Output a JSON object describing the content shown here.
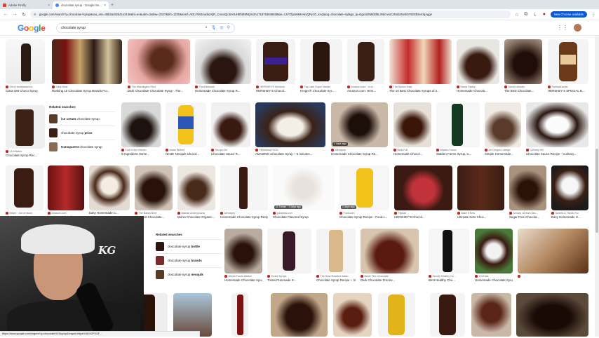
{
  "browser": {
    "tabs": [
      {
        "label": "Adobe Firefly",
        "active": false,
        "icon_color": "#e03c31"
      },
      {
        "label": "chocolate syrup - Google Se...",
        "active": true,
        "icon_color": "#4285f4"
      }
    ],
    "address": "google.com/search?q=chocolate+syrup&sca_esv=35b2ac82d41e2146&hl=en&udm=2&biw=2327&bih=1230&sxsrf=ADLYWIJcwdn2XjR_CmcxQLbm0UHBNE9NQ%3A1716753848528&ei=cJV7ZpUHBKAkvQPy1O_kAQ&oq=chocolate+syl&gs_lp=Egxnd3Mtd2l6LXNlcnAiC2Nob2NvbGF0ZSBzeXIqAggA",
    "new_chrome_label": "New Chrome available",
    "status_url": "https://www.google.com/imgres?q=chocolate%20syrup&imgurl=https%3A%2F%2F..."
  },
  "search": {
    "query": "chocolate syrup",
    "logo": "Google"
  },
  "colors": {
    "accent_blue": "#1a73e8",
    "chrome_blue": "#0b57d0"
  },
  "related_searches_1": {
    "heading": "Related searches",
    "items": [
      {
        "bold": "ice cream",
        "rest": " chocolate syrup"
      },
      {
        "bold": "",
        "rest": "chocolate syrup ",
        "tail": "price"
      },
      {
        "bold": "transparent",
        "rest": " chocolate syrup"
      }
    ]
  },
  "related_searches_2": {
    "heading": "Related searches",
    "items": [
      {
        "rest": "chocolate syrup ",
        "tail": "bottle"
      },
      {
        "rest": "chocolate syrup ",
        "tail": "brands"
      },
      {
        "rest": "chocolate syrup ",
        "tail": "nesquik"
      }
    ]
  },
  "results": [
    {
      "source": "Ohio Homestead Inc.",
      "title": "Class DM Choco Syrup"
    },
    {
      "source": "Daily Meal",
      "title": "Ranking 10 Chocolate Syrup Brands Fro..."
    },
    {
      "source": "The Washington Post",
      "title": "Dark Chocolate Chocolate Syrup - The..."
    },
    {
      "source": "Food Network",
      "title": "Homemade Chocolate Syrup R..."
    },
    {
      "source": "HERSHEY'S Kitchens",
      "title": "HERSHEY'S Chocol..."
    },
    {
      "source": "Fay Lake Super Market",
      "title": "Kroger® Chocolate Syr..."
    },
    {
      "source": "Amazon.com · In st...",
      "title": "Amazon.com: Hers..."
    },
    {
      "source": "The Spruce Eats",
      "title": "The 10 Best Chocolate Syrups of 2..."
    },
    {
      "source": "Rama Family",
      "title": "Homemade Chocola..."
    },
    {
      "source": "David Lebovitz",
      "title": "The Best Chocolate..."
    },
    {
      "source": "Pantry&Larder",
      "title": "HERSHEY'S SPECIAL D..."
    },
    {
      "source": "I Am Baker",
      "title": "Chocolate Syrup Rec..."
    },
    {
      "source": "Fork in the Kitchen",
      "title": "5-Ingredient Home..."
    },
    {
      "source": "Water Butlers",
      "title": "Nestle Nesquik Chocol..."
    },
    {
      "source": "Recipe Girl",
      "title": "Chocolate Sauce R..."
    },
    {
      "source": "FitDeliciouFOOD",
      "title": "AMAZING Chocolate Syrup ~ 5 minutes..."
    },
    {
      "source": "Allrecipes",
      "title": "Homemade Chocolate Syrup Re..."
    },
    {
      "source": "Bells Full",
      "title": "Homemade Chocol..."
    },
    {
      "source": "Walden Farms",
      "title": "Walden Farms Syrup, C..."
    },
    {
      "source": "An Oregon Cottage",
      "title": "Simple Homemade..."
    },
    {
      "source": "Culinary Hill",
      "title": "Chocolate Sauce Recipe - Culinary..."
    },
    {
      "source": "Meijer · Out of stock",
      "title": "HERSHEY'S Choc..."
    },
    {
      "source": "Amazon.com",
      "title": "Hershey's Chocolate..."
    },
    {
      "source": "Kitchen Treaty",
      "title": "Easy Homemade C..."
    },
    {
      "source": "The Baked Bree",
      "title": "The Best Chocolate..."
    },
    {
      "source": "Barista Underground",
      "title": "Monin Chocolate Organic..."
    },
    {
      "source": "Allrecipes",
      "title": "Homemade Chocolate Syrup Recipe"
    },
    {
      "source": "goodeats.com",
      "title": "Chocolate Flavored Syrup"
    },
    {
      "source": "Food.com",
      "title": "Chocolate Syrup Recipe - Food.c..."
    },
    {
      "source": "Flipkart",
      "title": "HERSHEY'S Chocol..."
    },
    {
      "source": "Bake It Keto",
      "title": "Ultimate Keto Choc..."
    },
    {
      "source": "All Day I Dream Abo...",
      "title": "Sugar Free Chocola..."
    },
    {
      "source": "Sweets & Thank You",
      "title": "Easy Homemade C..."
    },
    {
      "source": "Whole Foods Market",
      "title": "Homemade Chocolate Syrup Sugar F..."
    },
    {
      "source": "Torani Syrups",
      "title": "Torani Puremade S..."
    },
    {
      "source": "The Slow Roasted Italian",
      "title": "Chocolate Syrup Recipe + Video..."
    },
    {
      "source": "Beale Fine Chocolate",
      "title": "Dark Chocolate Premiu..."
    },
    {
      "source": "Savvily Healthy Ho...",
      "title": "Best Healthy Cho..."
    },
    {
      "source": "YouTube",
      "title": "Homemade Chocolate Syrup - YouTube"
    }
  ],
  "badges": {
    "days1": "4 days ago",
    "days2": "11 Tonlan · 3 days ago",
    "days3": "2 days ago"
  },
  "webcam_logo": "KG"
}
